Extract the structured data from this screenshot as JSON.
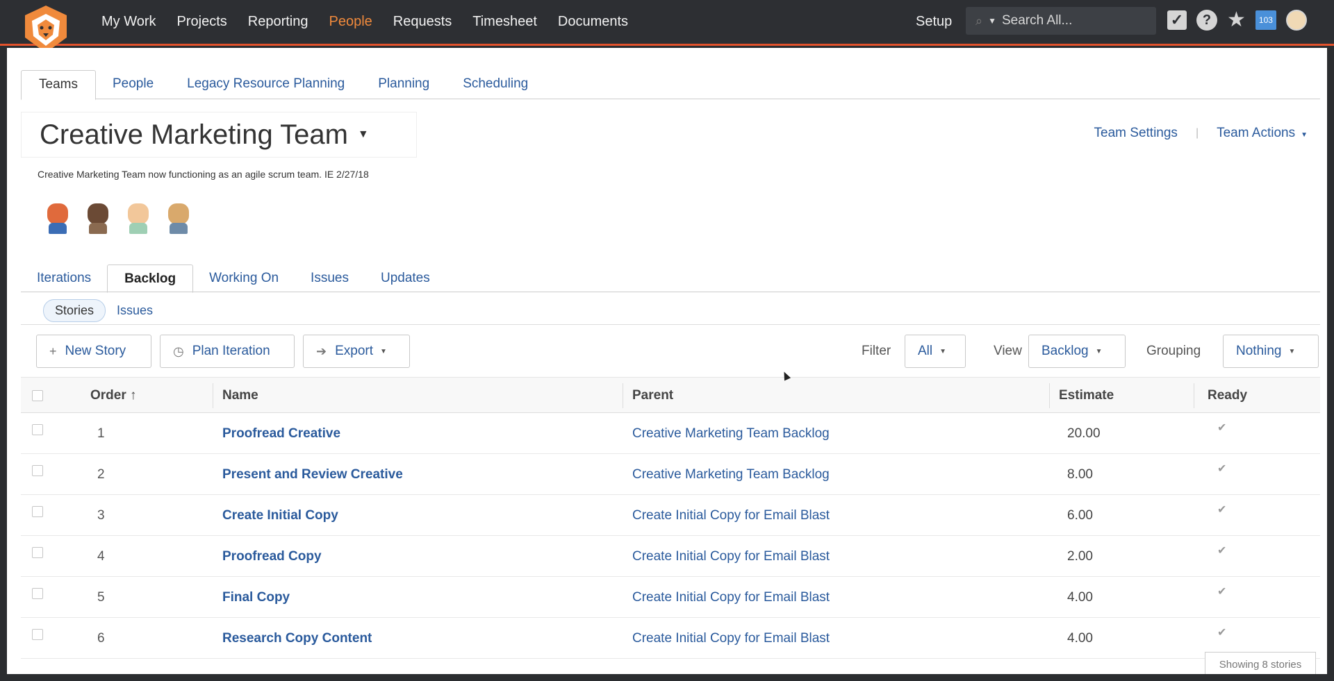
{
  "topnav": {
    "items": [
      {
        "label": "My Work",
        "active": false
      },
      {
        "label": "Projects",
        "active": false
      },
      {
        "label": "Reporting",
        "active": false
      },
      {
        "label": "People",
        "active": true
      },
      {
        "label": "Requests",
        "active": false
      },
      {
        "label": "Timesheet",
        "active": false
      },
      {
        "label": "Documents",
        "active": false
      }
    ],
    "setup_label": "Setup",
    "search_placeholder": "Search All...",
    "notifications_count": "103",
    "accent_color": "#f08a3c",
    "bar_underline_color": "#e2522c"
  },
  "page_tabs": [
    {
      "label": "Teams",
      "active": true
    },
    {
      "label": "People",
      "active": false
    },
    {
      "label": "Legacy Resource Planning",
      "active": false
    },
    {
      "label": "Planning",
      "active": false
    },
    {
      "label": "Scheduling",
      "active": false
    }
  ],
  "team": {
    "title": "Creative Marketing Team",
    "description": "Creative Marketing Team now functioning as an agile scrum team. IE 2/27/18",
    "settings_label": "Team Settings",
    "actions_label": "Team Actions"
  },
  "sub_tabs": [
    {
      "label": "Iterations",
      "active": false
    },
    {
      "label": "Backlog",
      "active": true
    },
    {
      "label": "Working On",
      "active": false
    },
    {
      "label": "Issues",
      "active": false
    },
    {
      "label": "Updates",
      "active": false
    }
  ],
  "pills": {
    "stories": "Stories",
    "issues": "Issues"
  },
  "toolbar": {
    "new_story": "New Story",
    "plan_iteration": "Plan Iteration",
    "export": "Export",
    "filter_label": "Filter",
    "filter_value": "All",
    "view_label": "View",
    "view_value": "Backlog",
    "grouping_label": "Grouping",
    "grouping_value": "Nothing"
  },
  "table": {
    "headers": {
      "order": "Order",
      "name": "Name",
      "parent": "Parent",
      "estimate": "Estimate",
      "ready": "Ready"
    },
    "rows": [
      {
        "order": "1",
        "name": "Proofread Creative",
        "parent": "Creative Marketing Team Backlog",
        "estimate": "20.00",
        "ready": "✔"
      },
      {
        "order": "2",
        "name": "Present and Review Creative",
        "parent": "Creative Marketing Team Backlog",
        "estimate": "8.00",
        "ready": "✔"
      },
      {
        "order": "3",
        "name": "Create Initial Copy",
        "parent": "Create Initial Copy for Email Blast",
        "estimate": "6.00",
        "ready": "✔"
      },
      {
        "order": "4",
        "name": "Proofread Copy",
        "parent": "Create Initial Copy for Email Blast",
        "estimate": "2.00",
        "ready": "✔"
      },
      {
        "order": "5",
        "name": "Final Copy",
        "parent": "Create Initial Copy for Email Blast",
        "estimate": "4.00",
        "ready": "✔"
      },
      {
        "order": "6",
        "name": "Research Copy Content",
        "parent": "Create Initial Copy for Email Blast",
        "estimate": "4.00",
        "ready": "✔"
      }
    ]
  },
  "footer": {
    "showing": "Showing 8 stories"
  }
}
